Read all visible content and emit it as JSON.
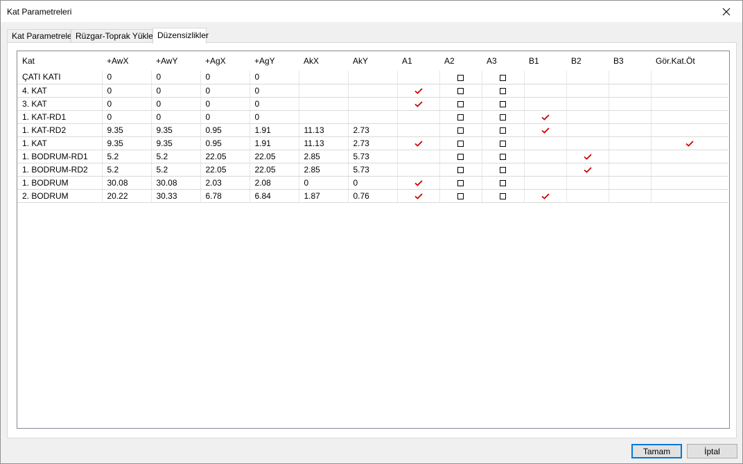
{
  "window": {
    "title": "Kat Parametreleri"
  },
  "tabs": [
    {
      "label": "Kat Parametreleri"
    },
    {
      "label": "Rüzgar-Toprak Yükleri"
    },
    {
      "label": "Düzensizlikler"
    }
  ],
  "columns": [
    "Kat",
    "+AwX",
    "+AwY",
    "+AgX",
    "+AgY",
    "AkX",
    "AkY",
    "A1",
    "A2",
    "A3",
    "B1",
    "B2",
    "B3",
    "Gör.Kat.Öt"
  ],
  "rows": [
    {
      "kat": "ÇATI KATI",
      "awx": "0",
      "awy": "0",
      "agx": "0",
      "agy": "0",
      "akx": "",
      "aky": "",
      "a1": false,
      "a2": false,
      "a3": false,
      "b1": false,
      "b2": false,
      "b3": false,
      "gor": false
    },
    {
      "kat": "4. KAT",
      "awx": "0",
      "awy": "0",
      "agx": "0",
      "agy": "0",
      "akx": "",
      "aky": "",
      "a1": true,
      "a2": false,
      "a3": false,
      "b1": false,
      "b2": false,
      "b3": false,
      "gor": false
    },
    {
      "kat": "3. KAT",
      "awx": "0",
      "awy": "0",
      "agx": "0",
      "agy": "0",
      "akx": "",
      "aky": "",
      "a1": true,
      "a2": false,
      "a3": false,
      "b1": false,
      "b2": false,
      "b3": false,
      "gor": false
    },
    {
      "kat": "1. KAT-RD1",
      "awx": "0",
      "awy": "0",
      "agx": "0",
      "agy": "0",
      "akx": "",
      "aky": "",
      "a1": false,
      "a2": false,
      "a3": false,
      "b1": true,
      "b2": false,
      "b3": false,
      "gor": false
    },
    {
      "kat": "1. KAT-RD2",
      "awx": "9.35",
      "awy": "9.35",
      "agx": "0.95",
      "agy": "1.91",
      "akx": "11.13",
      "aky": "2.73",
      "a1": false,
      "a2": false,
      "a3": false,
      "b1": true,
      "b2": false,
      "b3": false,
      "gor": false
    },
    {
      "kat": "1. KAT",
      "awx": "9.35",
      "awy": "9.35",
      "agx": "0.95",
      "agy": "1.91",
      "akx": "11.13",
      "aky": "2.73",
      "a1": true,
      "a2": false,
      "a3": false,
      "b1": false,
      "b2": false,
      "b3": false,
      "gor": true
    },
    {
      "kat": "1. BODRUM-RD1",
      "awx": "5.2",
      "awy": "5.2",
      "agx": "22.05",
      "agy": "22.05",
      "akx": "2.85",
      "aky": "5.73",
      "a1": false,
      "a2": false,
      "a3": false,
      "b1": false,
      "b2": true,
      "b3": false,
      "gor": false
    },
    {
      "kat": "1. BODRUM-RD2",
      "awx": "5.2",
      "awy": "5.2",
      "agx": "22.05",
      "agy": "22.05",
      "akx": "2.85",
      "aky": "5.73",
      "a1": false,
      "a2": false,
      "a3": false,
      "b1": false,
      "b2": true,
      "b3": false,
      "gor": false
    },
    {
      "kat": "1. BODRUM",
      "awx": "30.08",
      "awy": "30.08",
      "agx": "2.03",
      "agy": "2.08",
      "akx": "0",
      "aky": "0",
      "a1": true,
      "a2": false,
      "a3": false,
      "b1": false,
      "b2": false,
      "b3": false,
      "gor": false
    },
    {
      "kat": "2. BODRUM",
      "awx": "20.22",
      "awy": "30.33",
      "agx": "6.78",
      "agy": "6.84",
      "akx": "1.87",
      "aky": "0.76",
      "a1": true,
      "a2": false,
      "a3": false,
      "b1": true,
      "b2": false,
      "b3": false,
      "gor": false
    }
  ],
  "buttons": {
    "ok_label": "Tamam",
    "cancel_label": "İptal"
  },
  "colors": {
    "check": "#cc0000",
    "focus_border": "#0078d7"
  }
}
